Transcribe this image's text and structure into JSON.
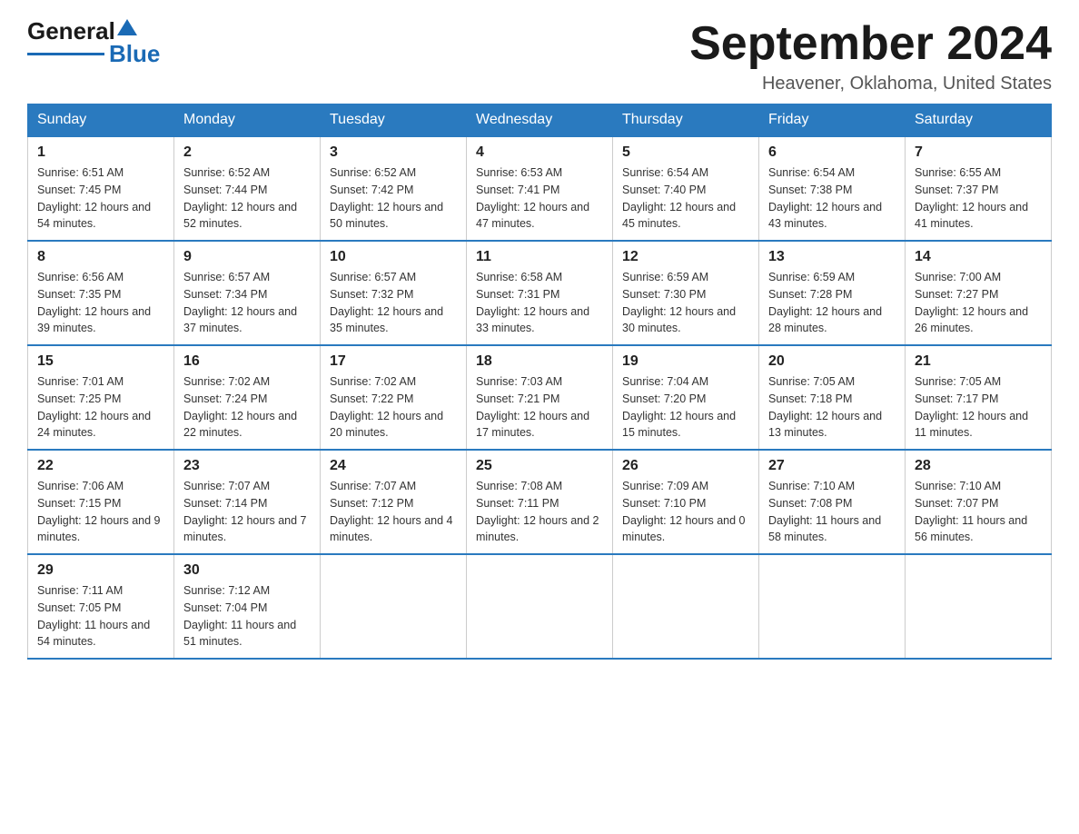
{
  "logo": {
    "text_general": "General",
    "text_blue": "Blue"
  },
  "header": {
    "month": "September 2024",
    "location": "Heavener, Oklahoma, United States"
  },
  "weekdays": [
    "Sunday",
    "Monday",
    "Tuesday",
    "Wednesday",
    "Thursday",
    "Friday",
    "Saturday"
  ],
  "weeks": [
    [
      {
        "day": "1",
        "sunrise": "6:51 AM",
        "sunset": "7:45 PM",
        "daylight": "12 hours and 54 minutes."
      },
      {
        "day": "2",
        "sunrise": "6:52 AM",
        "sunset": "7:44 PM",
        "daylight": "12 hours and 52 minutes."
      },
      {
        "day": "3",
        "sunrise": "6:52 AM",
        "sunset": "7:42 PM",
        "daylight": "12 hours and 50 minutes."
      },
      {
        "day": "4",
        "sunrise": "6:53 AM",
        "sunset": "7:41 PM",
        "daylight": "12 hours and 47 minutes."
      },
      {
        "day": "5",
        "sunrise": "6:54 AM",
        "sunset": "7:40 PM",
        "daylight": "12 hours and 45 minutes."
      },
      {
        "day": "6",
        "sunrise": "6:54 AM",
        "sunset": "7:38 PM",
        "daylight": "12 hours and 43 minutes."
      },
      {
        "day": "7",
        "sunrise": "6:55 AM",
        "sunset": "7:37 PM",
        "daylight": "12 hours and 41 minutes."
      }
    ],
    [
      {
        "day": "8",
        "sunrise": "6:56 AM",
        "sunset": "7:35 PM",
        "daylight": "12 hours and 39 minutes."
      },
      {
        "day": "9",
        "sunrise": "6:57 AM",
        "sunset": "7:34 PM",
        "daylight": "12 hours and 37 minutes."
      },
      {
        "day": "10",
        "sunrise": "6:57 AM",
        "sunset": "7:32 PM",
        "daylight": "12 hours and 35 minutes."
      },
      {
        "day": "11",
        "sunrise": "6:58 AM",
        "sunset": "7:31 PM",
        "daylight": "12 hours and 33 minutes."
      },
      {
        "day": "12",
        "sunrise": "6:59 AM",
        "sunset": "7:30 PM",
        "daylight": "12 hours and 30 minutes."
      },
      {
        "day": "13",
        "sunrise": "6:59 AM",
        "sunset": "7:28 PM",
        "daylight": "12 hours and 28 minutes."
      },
      {
        "day": "14",
        "sunrise": "7:00 AM",
        "sunset": "7:27 PM",
        "daylight": "12 hours and 26 minutes."
      }
    ],
    [
      {
        "day": "15",
        "sunrise": "7:01 AM",
        "sunset": "7:25 PM",
        "daylight": "12 hours and 24 minutes."
      },
      {
        "day": "16",
        "sunrise": "7:02 AM",
        "sunset": "7:24 PM",
        "daylight": "12 hours and 22 minutes."
      },
      {
        "day": "17",
        "sunrise": "7:02 AM",
        "sunset": "7:22 PM",
        "daylight": "12 hours and 20 minutes."
      },
      {
        "day": "18",
        "sunrise": "7:03 AM",
        "sunset": "7:21 PM",
        "daylight": "12 hours and 17 minutes."
      },
      {
        "day": "19",
        "sunrise": "7:04 AM",
        "sunset": "7:20 PM",
        "daylight": "12 hours and 15 minutes."
      },
      {
        "day": "20",
        "sunrise": "7:05 AM",
        "sunset": "7:18 PM",
        "daylight": "12 hours and 13 minutes."
      },
      {
        "day": "21",
        "sunrise": "7:05 AM",
        "sunset": "7:17 PM",
        "daylight": "12 hours and 11 minutes."
      }
    ],
    [
      {
        "day": "22",
        "sunrise": "7:06 AM",
        "sunset": "7:15 PM",
        "daylight": "12 hours and 9 minutes."
      },
      {
        "day": "23",
        "sunrise": "7:07 AM",
        "sunset": "7:14 PM",
        "daylight": "12 hours and 7 minutes."
      },
      {
        "day": "24",
        "sunrise": "7:07 AM",
        "sunset": "7:12 PM",
        "daylight": "12 hours and 4 minutes."
      },
      {
        "day": "25",
        "sunrise": "7:08 AM",
        "sunset": "7:11 PM",
        "daylight": "12 hours and 2 minutes."
      },
      {
        "day": "26",
        "sunrise": "7:09 AM",
        "sunset": "7:10 PM",
        "daylight": "12 hours and 0 minutes."
      },
      {
        "day": "27",
        "sunrise": "7:10 AM",
        "sunset": "7:08 PM",
        "daylight": "11 hours and 58 minutes."
      },
      {
        "day": "28",
        "sunrise": "7:10 AM",
        "sunset": "7:07 PM",
        "daylight": "11 hours and 56 minutes."
      }
    ],
    [
      {
        "day": "29",
        "sunrise": "7:11 AM",
        "sunset": "7:05 PM",
        "daylight": "11 hours and 54 minutes."
      },
      {
        "day": "30",
        "sunrise": "7:12 AM",
        "sunset": "7:04 PM",
        "daylight": "11 hours and 51 minutes."
      },
      null,
      null,
      null,
      null,
      null
    ]
  ]
}
